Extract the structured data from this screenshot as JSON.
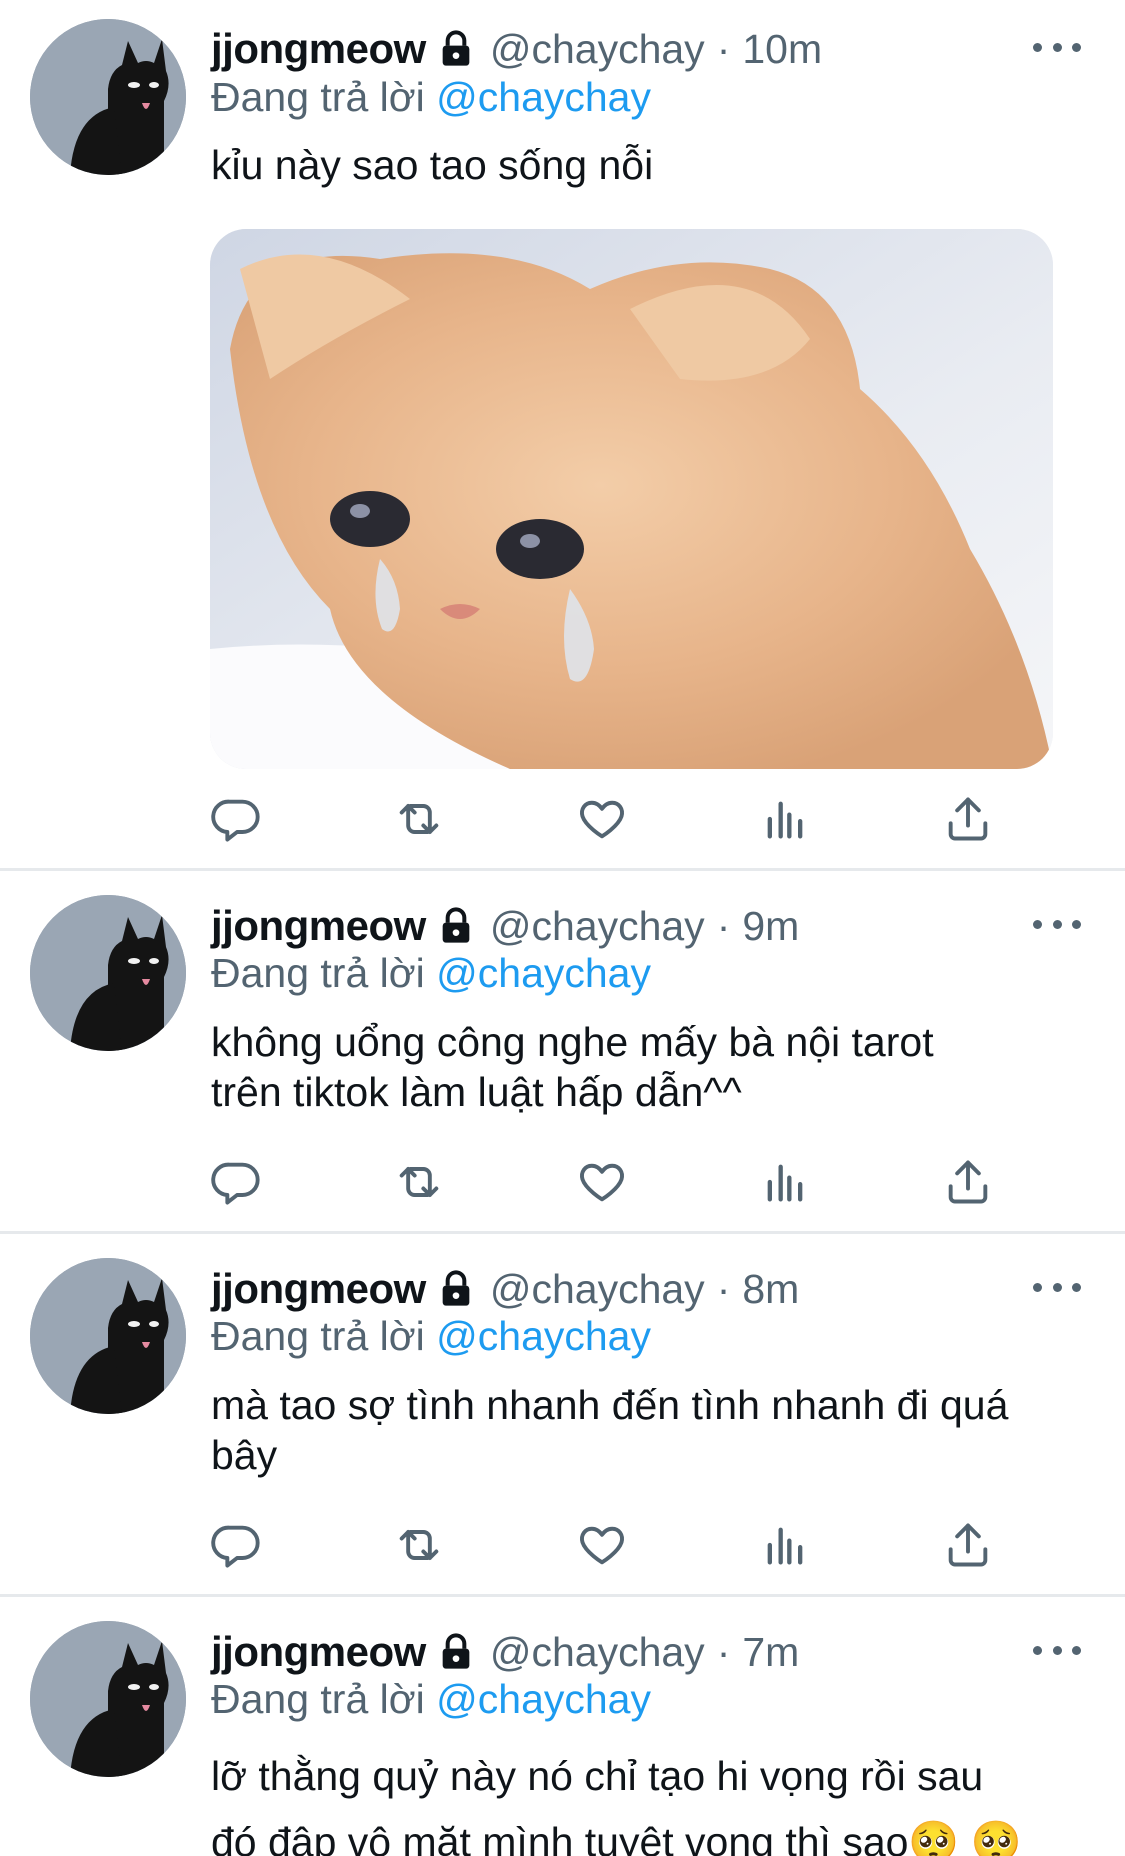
{
  "colors": {
    "text_primary": "#0f1419",
    "text_secondary": "#536471",
    "mention_blue": "#1d9bf0",
    "divider": "#e6e9ec"
  },
  "tweets": [
    {
      "display_name": "jjongmeow",
      "handle": "@chaychay",
      "separator": "·",
      "time": "10m",
      "replying_prefix": "Đang trả lời",
      "replying_to": "@chaychay",
      "text": "kỉu này sao tao sống nỗi",
      "has_media": true,
      "media_description": "crying-kitten-photo"
    },
    {
      "display_name": "jjongmeow",
      "handle": "@chaychay",
      "separator": "·",
      "time": "9m",
      "replying_prefix": "Đang trả lời",
      "replying_to": "@chaychay",
      "text": "không uổng công nghe mấy bà nội tarot\ntrên tiktok làm luật hấp dẫn^^",
      "has_media": false
    },
    {
      "display_name": "jjongmeow",
      "handle": "@chaychay",
      "separator": "·",
      "time": "8m",
      "replying_prefix": "Đang trả lời",
      "replying_to": "@chaychay",
      "text": "mà tao sợ tình nhanh đến tình nhanh đi quá\nbây",
      "has_media": false
    },
    {
      "display_name": "jjongmeow",
      "handle": "@chaychay",
      "separator": "·",
      "time": "7m",
      "replying_prefix": "Đang trả lời",
      "replying_to": "@chaychay",
      "text": "lỡ thằng quỷ này nó chỉ tạo hi vọng rồi sau\nđó đập vô mặt mình tuyệt vọng thì sao🥺 🥺",
      "has_media": false
    }
  ],
  "icons": {
    "avatar": "black-cat-avatar",
    "lock": "lock-icon",
    "more": "more-icon",
    "reply": "reply-icon",
    "retweet": "retweet-icon",
    "like": "like-icon",
    "analytics": "analytics-icon",
    "share": "share-icon"
  }
}
